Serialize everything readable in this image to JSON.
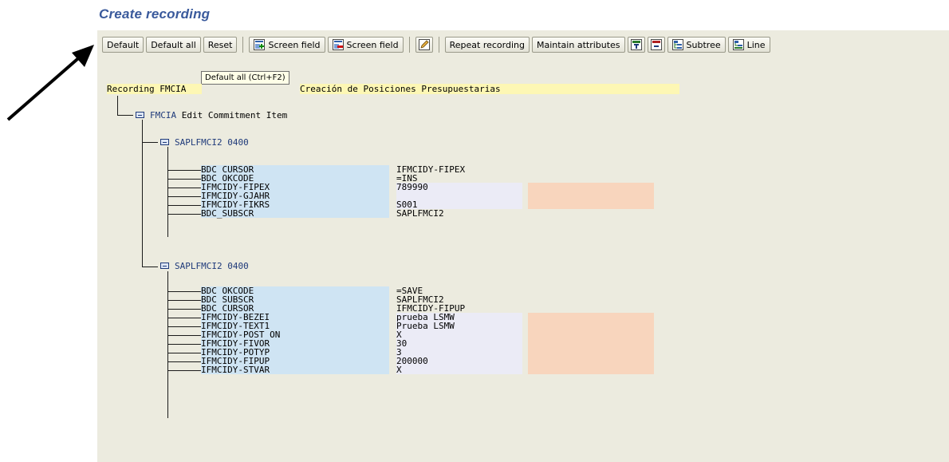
{
  "header": {
    "title": "Create recording"
  },
  "toolbar": {
    "default": "Default",
    "default_all": "Default all",
    "reset": "Reset",
    "screen_field_1": "Screen field",
    "screen_field_2": "Screen field",
    "repeat_recording": "Repeat recording",
    "maintain_attributes": "Maintain attributes",
    "subtree": "Subtree",
    "line": "Line"
  },
  "tooltip": "Default all  (Ctrl+F2)",
  "recording": {
    "label": "Recording FMCIA",
    "description": "Creación de Posiciones Presupuestarias",
    "transaction_code": "FMCIA",
    "transaction_text": "Edit Commitment Item"
  },
  "screens": [
    {
      "name": "SAPLFMCI2 0400",
      "fields": [
        {
          "name": "BDC_CURSOR",
          "value": "IFMCIDY-FIPEX"
        },
        {
          "name": "BDC_OKCODE",
          "value": "=INS"
        },
        {
          "name": "IFMCIDY-FIPEX",
          "value": "789990"
        },
        {
          "name": "IFMCIDY-GJAHR",
          "value": ""
        },
        {
          "name": "IFMCIDY-FIKRS",
          "value": "S001"
        },
        {
          "name": "BDC_SUBSCR",
          "value": "SAPLFMCI2"
        }
      ]
    },
    {
      "name": "SAPLFMCI2 0400",
      "fields": [
        {
          "name": "BDC_OKCODE",
          "value": "=SAVE"
        },
        {
          "name": "BDC_SUBSCR",
          "value": "SAPLFMCI2"
        },
        {
          "name": "BDC_CURSOR",
          "value": "IFMCIDY-FIPUP"
        },
        {
          "name": "IFMCIDY-BEZEI",
          "value": "prueba LSMW"
        },
        {
          "name": "IFMCIDY-TEXT1",
          "value": "Prueba LSMW"
        },
        {
          "name": "IFMCIDY-POST_ON",
          "value": "X"
        },
        {
          "name": "IFMCIDY-FIVOR",
          "value": "30"
        },
        {
          "name": "IFMCIDY-POTYP",
          "value": "3"
        },
        {
          "name": "IFMCIDY-FIPUP",
          "value": "200000"
        },
        {
          "name": "IFMCIDY-STVAR",
          "value": "X"
        }
      ]
    }
  ],
  "colors": {
    "title": "#3a5a9c",
    "panel": "#ecebdf",
    "field_name_bg": "#cfe4f3",
    "value_bg": "#ebebf6",
    "source_bg": "#f8d5bd",
    "header_bg": "#fdf7b4"
  }
}
